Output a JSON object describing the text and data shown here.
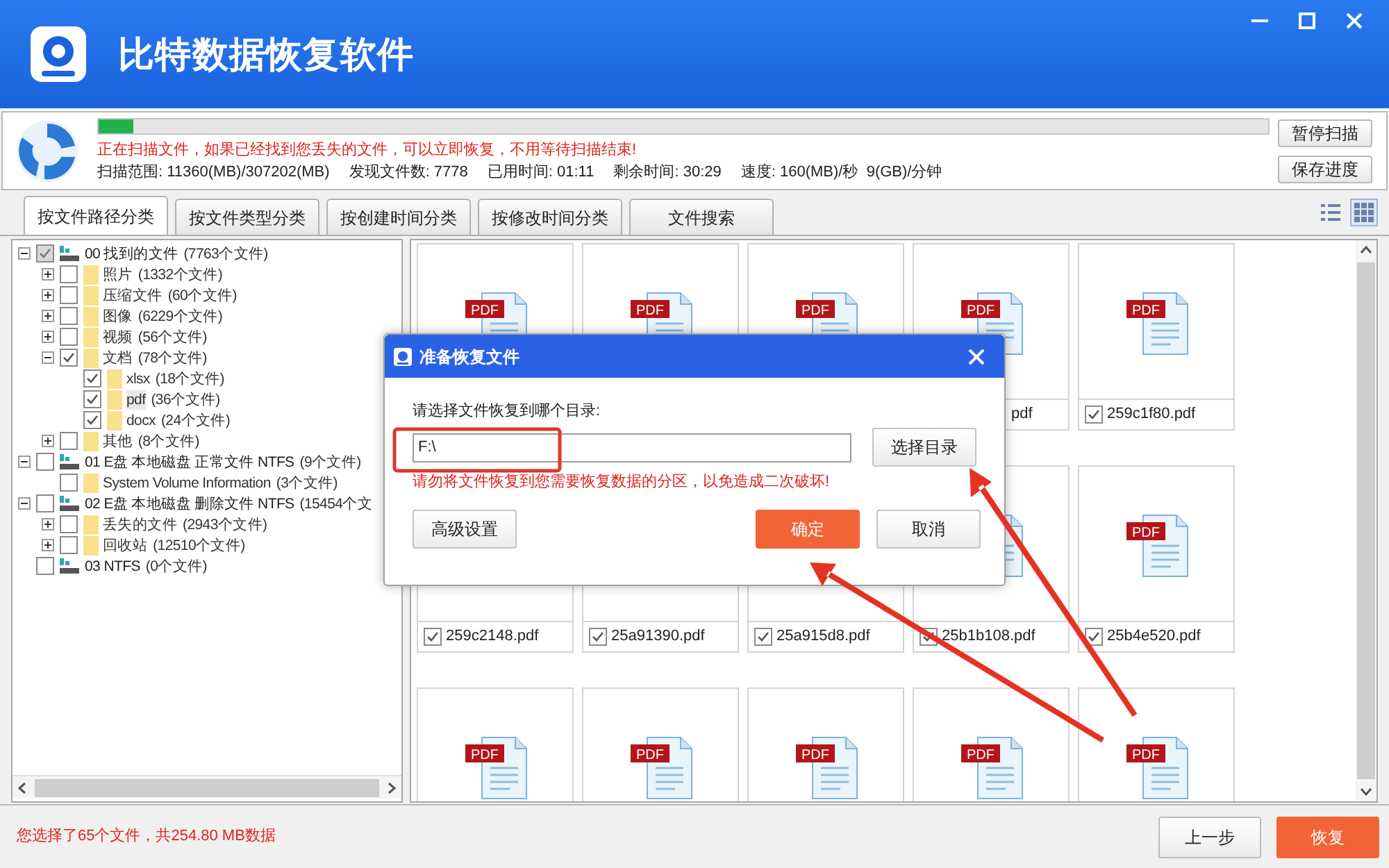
{
  "window": {
    "title": "比特数据恢复软件",
    "controls": [
      {
        "kind": "minimize"
      },
      {
        "kind": "maximize"
      },
      {
        "kind": "close"
      }
    ]
  },
  "scan": {
    "level": 0.03,
    "message": "正在扫描文件，如果已经找到您丢失的文件，可以立即恢复，不用等待扫描结束!",
    "stats": [
      "扫描范围: 11360(MB)/307202(MB)",
      "发现文件数: 7778",
      "已用时间: 01:11",
      "剩余时间: 30:29",
      "速度: 160(MB)/秒  9(GB)/分钟"
    ],
    "buttons": [
      "暂停扫描",
      "保存进度"
    ]
  },
  "tabs": [
    {
      "label": "按文件路径分类",
      "selected": true
    },
    {
      "label": "按文件类型分类",
      "selected": false
    },
    {
      "label": "按创建时间分类",
      "selected": false
    },
    {
      "label": "按修改时间分类",
      "selected": false
    },
    {
      "label": "文件搜索",
      "selected": false
    }
  ],
  "views": [
    {
      "kind": "list",
      "selected": false
    },
    {
      "kind": "grid",
      "selected": true
    }
  ],
  "tree": [
    {
      "kind": "drive",
      "label": "00 找到的文件",
      "count": "(7763个文件)",
      "checked": true,
      "partial": true,
      "expanded": true,
      "selected": false,
      "children": [
        {
          "kind": "folder",
          "label": "照片",
          "count": "(1332个文件)",
          "checked": false,
          "expanded": false,
          "selected": false
        },
        {
          "kind": "folder",
          "label": "压缩文件",
          "count": "(60个文件)",
          "checked": false,
          "expanded": false,
          "selected": false
        },
        {
          "kind": "folder",
          "label": "图像",
          "count": "(6229个文件)",
          "checked": false,
          "expanded": false,
          "selected": false
        },
        {
          "kind": "folder",
          "label": "视频",
          "count": "(56个文件)",
          "checked": false,
          "expanded": false,
          "selected": false
        },
        {
          "kind": "folder",
          "label": "文档",
          "count": "(78个文件)",
          "checked": true,
          "expanded": true,
          "selected": false,
          "children": [
            {
              "kind": "folder",
              "label": "xlsx",
              "count": "(18个文件)",
              "checked": true,
              "selected": false
            },
            {
              "kind": "folder",
              "label": "pdf",
              "count": "(36个文件)",
              "checked": true,
              "selected": true
            },
            {
              "kind": "folder",
              "label": "docx",
              "count": "(24个文件)",
              "checked": true,
              "selected": false
            }
          ]
        },
        {
          "kind": "folder",
          "label": "其他",
          "count": "(8个文件)",
          "checked": false,
          "expanded": false,
          "selected": false
        }
      ]
    },
    {
      "kind": "drive",
      "label": "01 E盘 本地磁盘 正常文件 NTFS",
      "count": "(9个文件)",
      "checked": false,
      "expanded": true,
      "selected": false,
      "children": [
        {
          "kind": "folder",
          "label": "System Volume Information",
          "count": "(3个文件)",
          "checked": false,
          "selected": false
        }
      ]
    },
    {
      "kind": "drive",
      "label": "02 E盘 本地磁盘 删除文件 NTFS",
      "count": "(15454个文",
      "checked": false,
      "expanded": true,
      "selected": false,
      "children": [
        {
          "kind": "folder",
          "label": "丢失的文件",
          "count": "(2943个文件)",
          "checked": false,
          "expanded": false,
          "selected": false
        },
        {
          "kind": "folder",
          "label": "回收站",
          "count": "(12510个文件)",
          "checked": false,
          "expanded": false,
          "selected": false
        }
      ]
    },
    {
      "kind": "drive",
      "label": "03 NTFS",
      "count": "(0个文件)",
      "checked": false,
      "selected": false
    }
  ],
  "files": [
    {
      "kind": "pdf",
      "badge": "PDF"
    },
    {
      "kind": "pdf",
      "badge": "PDF"
    },
    {
      "kind": "pdf",
      "badge": "PDF"
    },
    {
      "kind": "pdf",
      "badge": "PDF",
      "name": "pdf",
      "cut": true
    },
    {
      "kind": "pdf",
      "badge": "PDF",
      "name": "259c1f80.pdf",
      "checked": true
    },
    {
      "name": "259c2148.pdf",
      "checked": true
    },
    {
      "name": "25a91390.pdf",
      "checked": true
    },
    {
      "name": "25a915d8.pdf",
      "checked": true
    },
    {
      "kind": "pdf",
      "name": "25b1b108.pdf",
      "checked": true
    },
    {
      "kind": "pdf",
      "badge": "PDF",
      "name": "25b4e520.pdf",
      "checked": true
    },
    {
      "kind": "pdf",
      "badge": "PDF"
    },
    {
      "kind": "pdf",
      "badge": "PDF"
    },
    {
      "kind": "pdf",
      "badge": "PDF"
    },
    {
      "kind": "pdf",
      "badge": "PDF"
    },
    {
      "kind": "pdf",
      "badge": "PDF"
    }
  ],
  "dialog": {
    "title": "准备恢复文件",
    "prompt": "请选择文件恢复到哪个目录:",
    "path": "F:\\",
    "browse": "选择目录",
    "warning": "请勿将文件恢复到您需要恢复数据的分区，以免造成二次破坏!",
    "advanced": "高级设置",
    "ok": "确定",
    "cancel": "取消"
  },
  "status": "您选择了65个文件，共254.80 MB数据",
  "footer_buttons": [
    {
      "label": "上一步",
      "kind": "secondary"
    },
    {
      "label": "恢复",
      "kind": "primary"
    }
  ]
}
